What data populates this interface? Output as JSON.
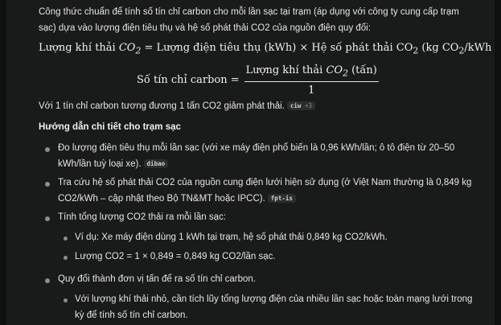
{
  "intro": "Công thức chuẩn để tính số tín chỉ carbon cho mỗi lần sạc tại trạm (áp dụng với công ty cung cấp trạm sạc) dựa vào lượng điện tiêu thụ và hệ số phát thải CO2 của nguồn điện quy đổi:",
  "formula1": {
    "lhs": "Lượng khí thải ",
    "eq_rest": " = Lượng điện tiêu thụ (kWh) × Hệ số phát thải CO",
    "unit_start": " (kg CO",
    "unit_end": "/kWh"
  },
  "formula2": {
    "lhs": "Số tín chỉ carbon = ",
    "num_start": "Lượng khí thải ",
    "num_end": " (tấn)",
    "den": "1"
  },
  "co2": {
    "c": "CO",
    "sub": "2"
  },
  "equivalence": {
    "text": "Với 1 tín chỉ carbon tương đương 1 tấn CO2 giảm phát thải.",
    "cite": "ciw",
    "cite_more": "+3"
  },
  "heading": "Hướng dẫn chi tiết cho trạm sạc",
  "items": [
    {
      "text": "Đo lượng điện tiêu thụ mỗi lần sạc (với xe máy điện phổ biến là 0,96 kWh/lần; ô tô điện từ 20–50 kWh/lần tuỳ loại xe).",
      "cite": "dibao"
    },
    {
      "text": "Tra cứu hệ số phát thải CO2 của nguồn cung điện lưới hiện sử dụng (ở Việt Nam thường là 0,849 kg CO2/kWh – cập nhật theo Bộ TN&MT hoặc IPCC).",
      "cite": "fpt-is"
    },
    {
      "text": "Tính tổng lượng CO2 thải ra mỗi lần sạc:"
    },
    {
      "text": "Ví dụ: Xe máy điện dùng 1 kWh tại trạm, hệ số phát thải 0,849 kg CO2/kWh."
    },
    {
      "text": "Lượng CO2 = 1 × 0,849 = 0,849 kg CO2/lần sạc."
    },
    {
      "text": "Quy đổi thành đơn vị tấn để ra số tín chỉ carbon."
    },
    {
      "text": "Với lượng khí thải nhỏ, cần tích lũy tổng lượng điện của nhiều lần sạc hoặc toàn mạng lưới trong kỳ để tính số tín chỉ carbon."
    }
  ]
}
